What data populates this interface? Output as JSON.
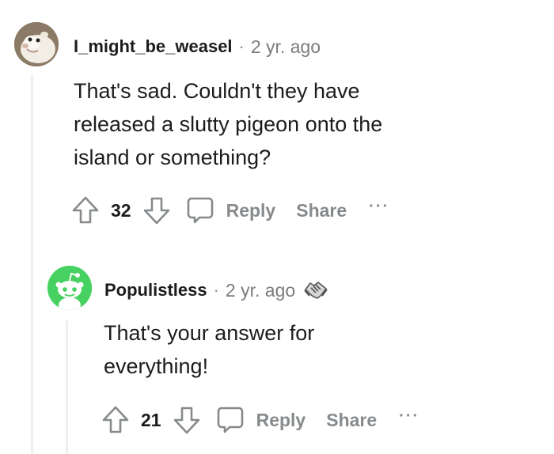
{
  "comments": [
    {
      "author": "I_might_be_weasel",
      "separator": "·",
      "time": "2 yr. ago",
      "body_lines": [
        "That's sad. Couldn't they have",
        "released a slutty pigeon onto the",
        "island or something?"
      ],
      "score": "32",
      "reply_label": "Reply",
      "share_label": "Share",
      "more_label": "···"
    },
    {
      "author": "Populistless",
      "separator": "·",
      "time": "2 yr. ago",
      "body_lines": [
        "That's your answer for",
        "everything!"
      ],
      "score": "21",
      "reply_label": "Reply",
      "share_label": "Share",
      "more_label": "···",
      "award": "handshake-award-icon"
    }
  ],
  "colors": {
    "thread_line": "#edeff1",
    "muted": "#878a8c",
    "text": "#1c1c1c",
    "snoo_bg": "#46d160"
  }
}
